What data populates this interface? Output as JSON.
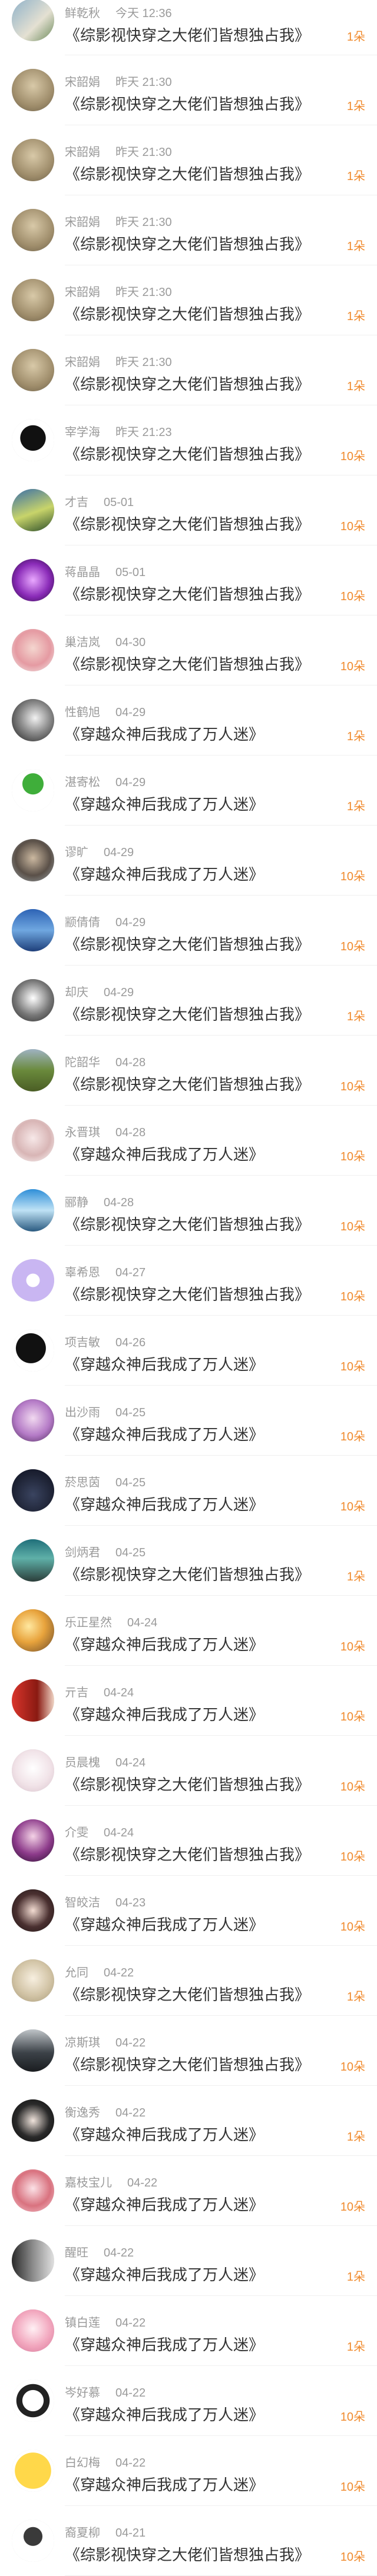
{
  "colors": {
    "amount": "#f08a2c",
    "meta": "#9a9a9a",
    "title": "#333333",
    "divider": "#f0f0f0"
  },
  "records": [
    {
      "name": "鲜乾秋",
      "time": "今天 12:36",
      "title": "《综影视快穿之大佬们皆想独占我》",
      "amount": "1朵",
      "avatar": "landscape-photo",
      "bg": "linear-gradient(135deg,#8fb2c9,#e4e0d2 60%,#6b8a5a)"
    },
    {
      "name": "宋韶娟",
      "time": "昨天 21:30",
      "title": "《综影视快穿之大佬们皆想独占我》",
      "amount": "1朵",
      "avatar": "couple-photo",
      "bg": "radial-gradient(circle at 50% 40%,#d8c9a8,#a08e6c 60%,#6d6048)"
    },
    {
      "name": "宋韶娟",
      "time": "昨天 21:30",
      "title": "《综影视快穿之大佬们皆想独占我》",
      "amount": "1朵",
      "avatar": "couple-photo",
      "bg": "radial-gradient(circle at 50% 40%,#d8c9a8,#a08e6c 60%,#6d6048)"
    },
    {
      "name": "宋韶娟",
      "time": "昨天 21:30",
      "title": "《综影视快穿之大佬们皆想独占我》",
      "amount": "1朵",
      "avatar": "couple-photo",
      "bg": "radial-gradient(circle at 50% 40%,#d8c9a8,#a08e6c 60%,#6d6048)"
    },
    {
      "name": "宋韶娟",
      "time": "昨天 21:30",
      "title": "《综影视快穿之大佬们皆想独占我》",
      "amount": "1朵",
      "avatar": "couple-photo",
      "bg": "radial-gradient(circle at 50% 40%,#d8c9a8,#a08e6c 60%,#6d6048)"
    },
    {
      "name": "宋韶娟",
      "time": "昨天 21:30",
      "title": "《综影视快穿之大佬们皆想独占我》",
      "amount": "1朵",
      "avatar": "couple-photo",
      "bg": "radial-gradient(circle at 50% 40%,#d8c9a8,#a08e6c 60%,#6d6048)"
    },
    {
      "name": "宰学海",
      "time": "昨天 21:23",
      "title": "《综影视快穿之大佬们皆想独占我》",
      "amount": "10朵",
      "avatar": "penguin-icon",
      "bg": "radial-gradient(circle at 50% 45%,#111 0 40%,#ffffff 41% 100%)"
    },
    {
      "name": "才吉",
      "time": "05-01",
      "title": "《综影视快穿之大佬们皆想独占我》",
      "amount": "10朵",
      "avatar": "car-photo",
      "bg": "linear-gradient(160deg,#3a6fa8,#c8d46a 55%,#2d4f2a)"
    },
    {
      "name": "蒋晶晶",
      "time": "05-01",
      "title": "《综影视快穿之大佬们皆想独占我》",
      "amount": "10朵",
      "avatar": "neon-photo",
      "bg": "radial-gradient(circle at 50% 50%,#e9a8ff,#8a2bb8 55%,#2b0b40)"
    },
    {
      "name": "巢洁岚",
      "time": "04-30",
      "title": "《综影视快穿之大佬们皆想独占我》",
      "amount": "10朵",
      "avatar": "girl-photo",
      "bg": "radial-gradient(circle at 50% 45%,#f4d6cf,#e59aa2 55%,#f3f0ee)"
    },
    {
      "name": "性鹤旭",
      "time": "04-29",
      "title": "《穿越众神后我成了万人迷》",
      "amount": "1朵",
      "avatar": "bw-portrait",
      "bg": "radial-gradient(circle at 55% 45%,#f2f2f2,#8c8c8c 45%,#1a1a1a)"
    },
    {
      "name": "湛寄松",
      "time": "04-29",
      "title": "《穿越众神后我成了万人迷》",
      "amount": "1朵",
      "avatar": "cartoon-figure",
      "bg": "radial-gradient(circle at 50% 35%,#3fae3a 0 30%,#ffffff 31% 100%)"
    },
    {
      "name": "谬旷",
      "time": "04-29",
      "title": "《穿越众神后我成了万人迷》",
      "amount": "10朵",
      "avatar": "man-photo",
      "bg": "radial-gradient(circle at 50% 45%,#cbb8a0,#5a5048 55%,#9aa3a8)"
    },
    {
      "name": "颛倩倩",
      "time": "04-29",
      "title": "《综影视快穿之大佬们皆想独占我》",
      "amount": "10朵",
      "avatar": "sea-photo",
      "bg": "linear-gradient(180deg,#2d63b5,#6fa7e0 50%,#1e3f7a)"
    },
    {
      "name": "却庆",
      "time": "04-29",
      "title": "《综影视快穿之大佬们皆想独占我》",
      "amount": "1朵",
      "avatar": "sketch-portrait",
      "bg": "radial-gradient(circle at 50% 45%,#ffffff,#777 55%,#2a2a2a)"
    },
    {
      "name": "陀韶华",
      "time": "04-28",
      "title": "《综影视快穿之大佬们皆想独占我》",
      "amount": "10朵",
      "avatar": "field-photo",
      "bg": "linear-gradient(180deg,#9fb3c2,#6a8a3c 50%,#4a5d24)"
    },
    {
      "name": "永晋琪",
      "time": "04-28",
      "title": "《穿越众神后我成了万人迷》",
      "amount": "10朵",
      "avatar": "anime-couple",
      "bg": "radial-gradient(circle at 50% 45%,#f7e8e8,#d8b5b5 55%,#ffffff)"
    },
    {
      "name": "郦静",
      "time": "04-28",
      "title": "《综影视快穿之大佬们皆想独占我》",
      "amount": "10朵",
      "avatar": "mountain-photo",
      "bg": "linear-gradient(180deg,#2f8fd8,#bfe2f5 50%,#2a5a80)"
    },
    {
      "name": "辜希恩",
      "time": "04-27",
      "title": "《综影视快穿之大佬们皆想独占我》",
      "amount": "10朵",
      "avatar": "chat-bubble-icon",
      "bg": "radial-gradient(circle at 50% 50%,#ffffff 0 22%,#c9b6f2 23% 100%)"
    },
    {
      "name": "项吉敏",
      "time": "04-26",
      "title": "《穿越众神后我成了万人迷》",
      "amount": "10朵",
      "avatar": "silhouette",
      "bg": "radial-gradient(circle at 45% 45%,#111 0 45%,#ffffff 46% 100%)"
    },
    {
      "name": "出沙雨",
      "time": "04-25",
      "title": "《穿越众神后我成了万人迷》",
      "amount": "10朵",
      "avatar": "purple-portrait",
      "bg": "radial-gradient(circle at 50% 45%,#f1d9f0,#b47ac6 55%,#4c2a5a)"
    },
    {
      "name": "菸思茵",
      "time": "04-25",
      "title": "《穿越众神后我成了万人迷》",
      "amount": "10朵",
      "avatar": "night-tree",
      "bg": "radial-gradient(circle at 50% 60%,#3a4460,#1e2335 60%,#0d1020)"
    },
    {
      "name": "剑炳君",
      "time": "04-25",
      "title": "《综影视快穿之大佬们皆想独占我》",
      "amount": "1朵",
      "avatar": "teal-landscape",
      "bg": "linear-gradient(180deg,#1f6f7a,#5fb0a8 45%,#2b3e3a)"
    },
    {
      "name": "乐正星然",
      "time": "04-24",
      "title": "《穿越众神后我成了万人迷》",
      "amount": "10朵",
      "avatar": "sunset-photo",
      "bg": "radial-gradient(circle at 40% 40%,#ffe8a0,#e8a33c 45%,#6a4a2a)"
    },
    {
      "name": "亓吉",
      "time": "04-24",
      "title": "《穿越众神后我成了万人迷》",
      "amount": "10朵",
      "avatar": "red-photo",
      "bg": "linear-gradient(90deg,#d9352c,#8a1a12 60%,#f0d6c6)"
    },
    {
      "name": "员晨槐",
      "time": "04-24",
      "title": "《综影视快穿之大佬们皆想独占我》",
      "amount": "10朵",
      "avatar": "anime-white",
      "bg": "radial-gradient(circle at 50% 45%,#ffffff,#f1e3e8 55%,#d9c2cc)"
    },
    {
      "name": "介雯",
      "time": "04-24",
      "title": "《综影视快穿之大佬们皆想独占我》",
      "amount": "10朵",
      "avatar": "anime-purple",
      "bg": "radial-gradient(circle at 50% 40%,#f4d2e6,#8c3a8a 55%,#2a1030)"
    },
    {
      "name": "智皎洁",
      "time": "04-23",
      "title": "《穿越众神后我成了万人迷》",
      "amount": "10朵",
      "avatar": "dark-hair-girl",
      "bg": "radial-gradient(circle at 50% 50%,#f3dcd2,#4a3030 55%,#1e1414)"
    },
    {
      "name": "允同",
      "time": "04-22",
      "title": "《综影视快穿之大佬们皆想独占我》",
      "amount": "1朵",
      "avatar": "child-photo",
      "bg": "radial-gradient(circle at 50% 45%,#f7efe0,#d2c4a6 55%,#a89a78)"
    },
    {
      "name": "凉斯琪",
      "time": "04-22",
      "title": "《综影视快穿之大佬们皆想独占我》",
      "amount": "10朵",
      "avatar": "car-bw",
      "bg": "linear-gradient(180deg,#bfc4c8,#3c4248 55%,#1a1d20)"
    },
    {
      "name": "衡逸秀",
      "time": "04-22",
      "title": "《穿越众神后我成了万人迷》",
      "amount": "1朵",
      "avatar": "black-hair",
      "bg": "radial-gradient(circle at 50% 50%,#f0e4dc,#2a2a2a 55%,#0a0a0a)"
    },
    {
      "name": "嘉枝宝儿",
      "time": "04-22",
      "title": "《穿越众神后我成了万人迷》",
      "amount": "10朵",
      "avatar": "pink-anime",
      "bg": "radial-gradient(circle at 50% 45%,#fbe1e6,#d9727f 55%,#f4c7cf)"
    },
    {
      "name": "醒旺",
      "time": "04-22",
      "title": "《穿越众神后我成了万人迷》",
      "amount": "1朵",
      "avatar": "bw-figure",
      "bg": "linear-gradient(90deg,#2a2a2a,#8c8c8c 50%,#e0e0e0)"
    },
    {
      "name": "镇白莲",
      "time": "04-22",
      "title": "《穿越众神后我成了万人迷》",
      "amount": "1朵",
      "avatar": "pink-hair",
      "bg": "radial-gradient(circle at 50% 45%,#fff0f4,#f2a7be 55%,#d7789a)"
    },
    {
      "name": "岑好慕",
      "time": "04-22",
      "title": "《穿越众神后我成了万人迷》",
      "amount": "10朵",
      "avatar": "cartoon-couple",
      "bg": "radial-gradient(circle at 50% 50%,#ffffff 0 35%,#222 36% 55%,#ffffff 56% 100%)"
    },
    {
      "name": "白幻梅",
      "time": "04-22",
      "title": "《穿越众神后我成了万人迷》",
      "amount": "10朵",
      "avatar": "yellow-emoji",
      "bg": "radial-gradient(circle at 50% 50%,#ffd84a 0 60%,#ffffff 61% 100%)"
    },
    {
      "name": "裔夏柳",
      "time": "04-21",
      "title": "《综影视快穿之大佬们皆想独占我》",
      "amount": "10朵",
      "avatar": "cartoon-badge",
      "bg": "radial-gradient(circle at 50% 40%,#3a3a3a 0 28%,#ffffff 29% 100%)"
    }
  ]
}
